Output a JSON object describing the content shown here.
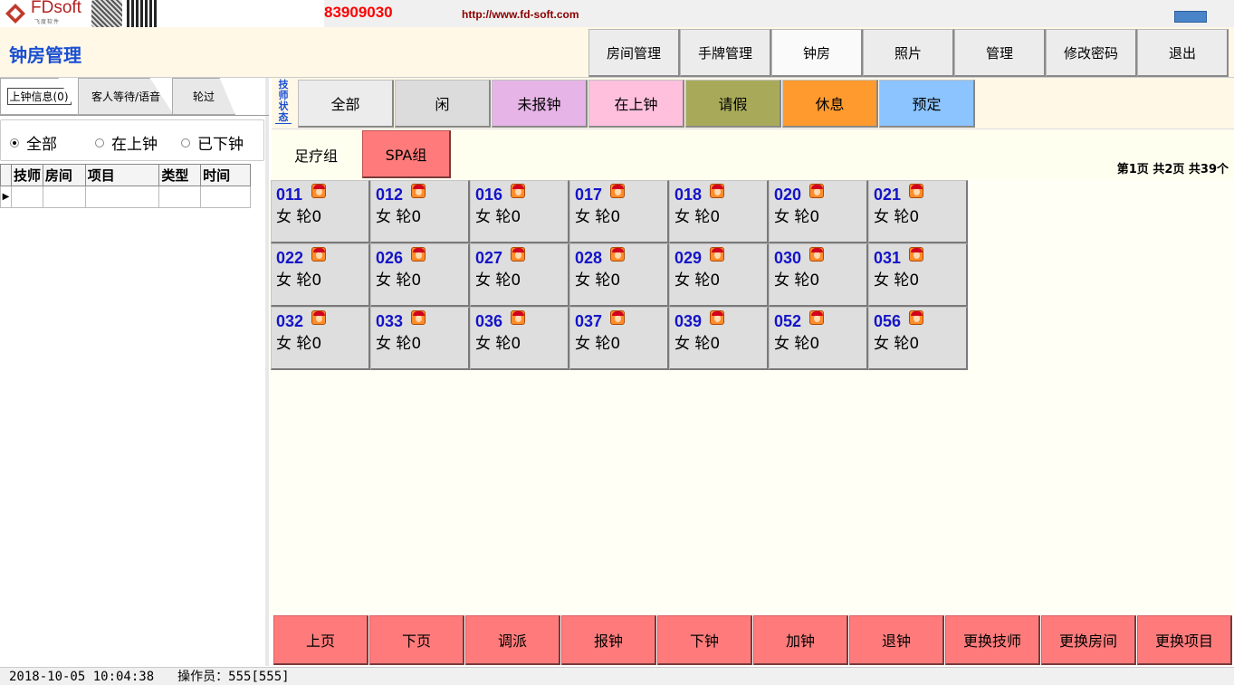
{
  "header": {
    "logo_text": "FDsoft",
    "logo_sub": "飞度软件",
    "phone": "83909030",
    "url": "http://www.fd-soft.com"
  },
  "title": "钟房管理",
  "nav": [
    {
      "label": "房间管理",
      "active": false
    },
    {
      "label": "手牌管理",
      "active": false
    },
    {
      "label": "钟房",
      "active": true
    },
    {
      "label": "照片",
      "active": false
    },
    {
      "label": "管理",
      "active": false
    },
    {
      "label": "修改密码",
      "active": false
    },
    {
      "label": "退出",
      "active": false
    }
  ],
  "left": {
    "tabs": [
      "上钟信息(0)",
      "客人等待/语音",
      "轮过"
    ],
    "radios": [
      {
        "label": "全部",
        "checked": true
      },
      {
        "label": "在上钟",
        "checked": false
      },
      {
        "label": "已下钟",
        "checked": false
      }
    ],
    "columns": [
      "技师",
      "房间",
      "项目",
      "类型",
      "时间"
    ]
  },
  "status": {
    "label": "技师状态",
    "filters": [
      {
        "label": "全部",
        "color": "#ececec"
      },
      {
        "label": "闲",
        "color": "#dcdcdc"
      },
      {
        "label": "未报钟",
        "color": "#e6b4e6"
      },
      {
        "label": "在上钟",
        "color": "#ffc0de"
      },
      {
        "label": "请假",
        "color": "#a8aa5a"
      },
      {
        "label": "休息",
        "color": "#ff9a2e"
      },
      {
        "label": "预定",
        "color": "#8cc4ff"
      }
    ]
  },
  "groups": [
    {
      "label": "足疗组",
      "color": "#fffff0"
    },
    {
      "label": "SPA组",
      "color": "#ff7b7b"
    }
  ],
  "page_info": "第1页  共2页  共39个",
  "technicians": [
    {
      "id": "011",
      "gender": "女",
      "turn": "轮0"
    },
    {
      "id": "012",
      "gender": "女",
      "turn": "轮0"
    },
    {
      "id": "016",
      "gender": "女",
      "turn": "轮0"
    },
    {
      "id": "017",
      "gender": "女",
      "turn": "轮0"
    },
    {
      "id": "018",
      "gender": "女",
      "turn": "轮0"
    },
    {
      "id": "020",
      "gender": "女",
      "turn": "轮0"
    },
    {
      "id": "021",
      "gender": "女",
      "turn": "轮0"
    },
    {
      "id": "022",
      "gender": "女",
      "turn": "轮0"
    },
    {
      "id": "026",
      "gender": "女",
      "turn": "轮0"
    },
    {
      "id": "027",
      "gender": "女",
      "turn": "轮0"
    },
    {
      "id": "028",
      "gender": "女",
      "turn": "轮0"
    },
    {
      "id": "029",
      "gender": "女",
      "turn": "轮0"
    },
    {
      "id": "030",
      "gender": "女",
      "turn": "轮0"
    },
    {
      "id": "031",
      "gender": "女",
      "turn": "轮0"
    },
    {
      "id": "032",
      "gender": "女",
      "turn": "轮0"
    },
    {
      "id": "033",
      "gender": "女",
      "turn": "轮0"
    },
    {
      "id": "036",
      "gender": "女",
      "turn": "轮0"
    },
    {
      "id": "037",
      "gender": "女",
      "turn": "轮0"
    },
    {
      "id": "039",
      "gender": "女",
      "turn": "轮0"
    },
    {
      "id": "052",
      "gender": "女",
      "turn": "轮0"
    },
    {
      "id": "056",
      "gender": "女",
      "turn": "轮0"
    }
  ],
  "actions": [
    "上页",
    "下页",
    "调派",
    "报钟",
    "下钟",
    "加钟",
    "退钟",
    "更换技师",
    "更换房间",
    "更换项目"
  ],
  "footer": {
    "datetime": "2018-10-05 10:04:38",
    "operator": "操作员：555[555]"
  },
  "icons": {
    "logo": "fdsoft-logo-icon",
    "avatar": "technician-avatar-icon",
    "row_pointer": "row-pointer-icon"
  }
}
